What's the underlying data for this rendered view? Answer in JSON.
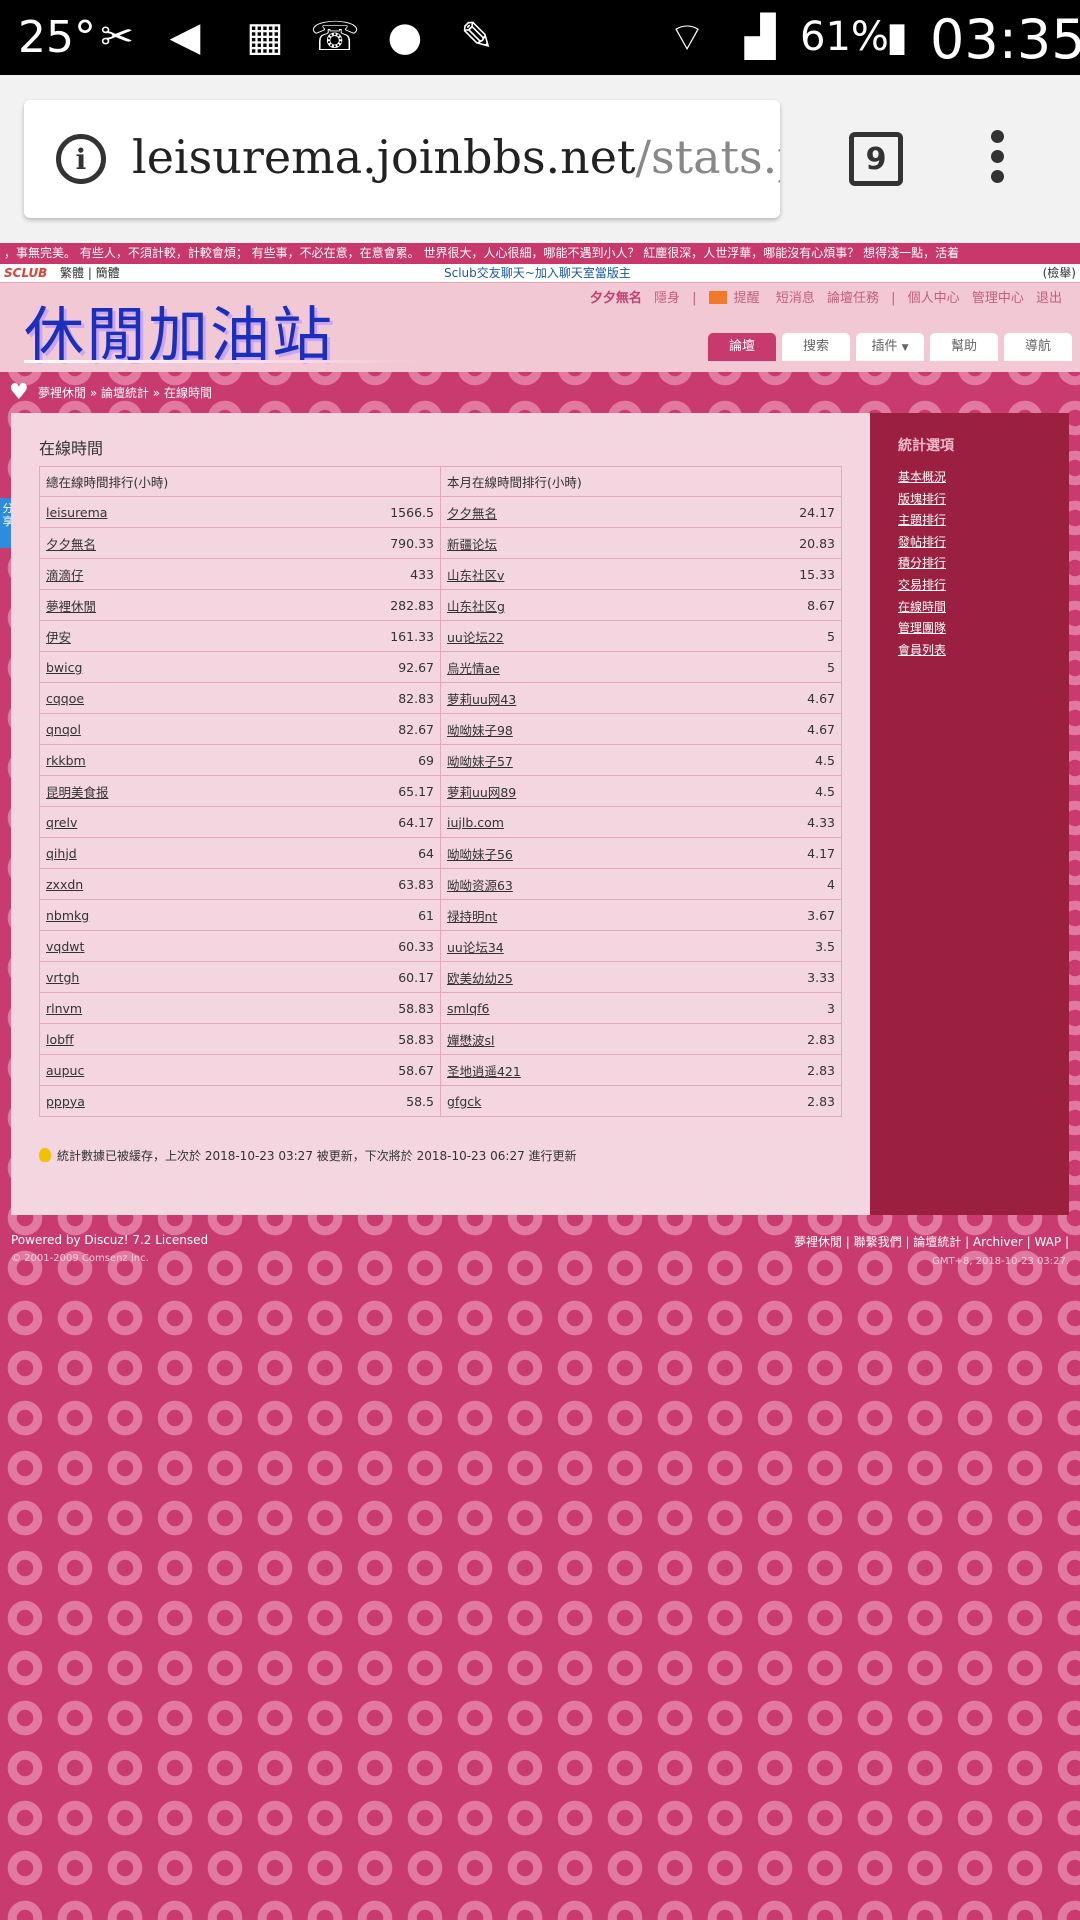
{
  "status_bar": {
    "temperature": "25°",
    "battery": "61%",
    "time": "03:35"
  },
  "browser": {
    "url_host": "leisurema.joinbbs.net",
    "url_path": "/stats.p",
    "tab_count": "9"
  },
  "ticker": "，事無完美。 有些人，不須計較，計較會煩； 有些事，不必在意，在意會累。 世界很大，人心很細，哪能不遇到小人？ 紅塵很深，人世浮華，哪能沒有心煩事？ 想得淺一點，活着",
  "topbar": {
    "logo": "SCLUB",
    "lang": "繁體 | 簡體",
    "chat_link": "Sclub交友聊天~加入聊天室當版主",
    "report": "(檢舉)"
  },
  "header": {
    "site_title": "休閒加油站",
    "user": "夕夕無名",
    "hide": "隱身",
    "notice": "提醒",
    "sms": "短消息",
    "tasks": "論壇任務",
    "profile": "個人中心",
    "admin": "管理中心",
    "logout": "退出",
    "tabs": [
      "論壇",
      "搜索",
      "插件",
      "幫助",
      "導航"
    ]
  },
  "breadcrumb": "夢裡休閒 » 論壇統計 » 在線時間",
  "share_tab": "分享",
  "main": {
    "title": "在線時間",
    "col_total": "總在線時間排行(小時)",
    "col_month": "本月在線時間排行(小時)",
    "rows": [
      {
        "u1": "leisurema",
        "v1": "1566.5",
        "u2": "夕夕無名",
        "v2": "24.17"
      },
      {
        "u1": "夕夕無名",
        "v1": "790.33",
        "u2": "新疆论坛",
        "v2": "20.83"
      },
      {
        "u1": "滴滴仔",
        "v1": "433",
        "u2": "山东社区v",
        "v2": "15.33"
      },
      {
        "u1": "夢裡休閒",
        "v1": "282.83",
        "u2": "山东社区g",
        "v2": "8.67"
      },
      {
        "u1": "伊安",
        "v1": "161.33",
        "u2": "uu论坛22",
        "v2": "5"
      },
      {
        "u1": "bwicg",
        "v1": "92.67",
        "u2": "烏光情ae",
        "v2": "5"
      },
      {
        "u1": "cqqoe",
        "v1": "82.83",
        "u2": "萝莉uu网43",
        "v2": "4.67"
      },
      {
        "u1": "qnqol",
        "v1": "82.67",
        "u2": "呦呦妹子98",
        "v2": "4.67"
      },
      {
        "u1": "rkkbm",
        "v1": "69",
        "u2": "呦呦妹子57",
        "v2": "4.5"
      },
      {
        "u1": "昆明美食报",
        "v1": "65.17",
        "u2": "萝莉uu网89",
        "v2": "4.5"
      },
      {
        "u1": "qrelv",
        "v1": "64.17",
        "u2": "iujlb.com",
        "v2": "4.33"
      },
      {
        "u1": "qihjd",
        "v1": "64",
        "u2": "呦呦妹子56",
        "v2": "4.17"
      },
      {
        "u1": "zxxdn",
        "v1": "63.83",
        "u2": "呦呦资源63",
        "v2": "4"
      },
      {
        "u1": "nbmkg",
        "v1": "61",
        "u2": "禄持明nt",
        "v2": "3.67"
      },
      {
        "u1": "vqdwt",
        "v1": "60.33",
        "u2": "uu论坛34",
        "v2": "3.5"
      },
      {
        "u1": "vrtgh",
        "v1": "60.17",
        "u2": "欧美幼幼25",
        "v2": "3.33"
      },
      {
        "u1": "rlnvm",
        "v1": "58.83",
        "u2": "smlqf6",
        "v2": "3"
      },
      {
        "u1": "lobff",
        "v1": "58.83",
        "u2": "嬋懋波sl",
        "v2": "2.83"
      },
      {
        "u1": "aupuc",
        "v1": "58.67",
        "u2": "圣地逍遥421",
        "v2": "2.83"
      },
      {
        "u1": "pppya",
        "v1": "58.5",
        "u2": "gfgck",
        "v2": "2.83"
      }
    ],
    "note": "統計數據已被緩存，上次於 2018-10-23 03:27 被更新，下次將於 2018-10-23 06:27 進行更新"
  },
  "sidebar": {
    "title": "統計選項",
    "links": [
      "基本概況",
      "版塊排行",
      "主題排行",
      "發帖排行",
      "積分排行",
      "交易排行",
      "在線時間",
      "管理團隊",
      "會員列表"
    ]
  },
  "footer": {
    "powered": "Powered by Discuz! 7.2 Licensed",
    "copyright": "© 2001-2009 Comsenz Inc.",
    "links": "夢裡休閒 | 聯繫我們 | 論壇統計 | Archiver | WAP |",
    "timestamp": "GMT+8, 2018-10-23 03:27."
  }
}
